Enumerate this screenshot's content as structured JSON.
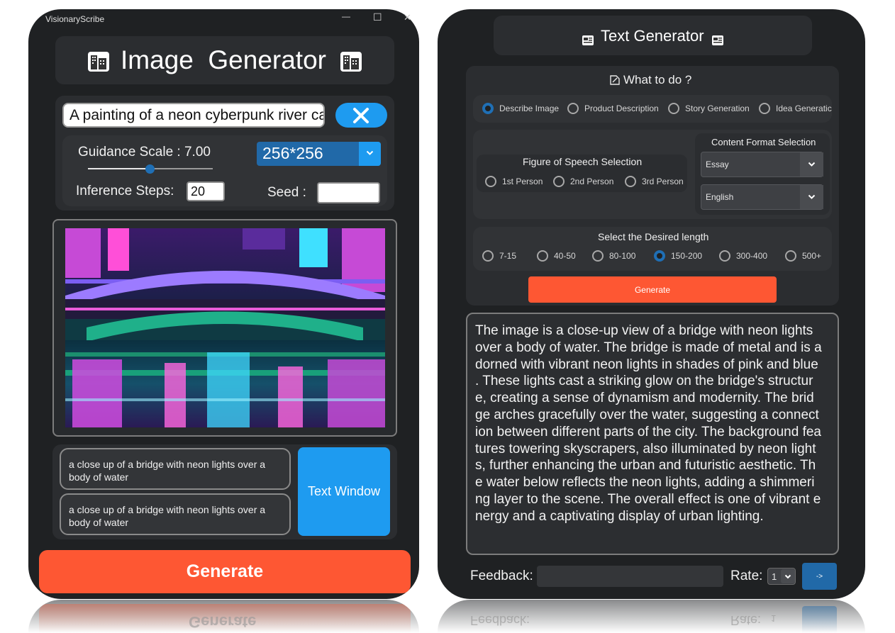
{
  "window": {
    "title": "VisionaryScribe",
    "minimize_glyph": "—",
    "maximize_glyph": "☐",
    "close_glyph": "✕"
  },
  "left": {
    "header_title": "Image  Generator",
    "prompt_value": "A painting of a neon cyberpunk river ca",
    "guidance_label": "Guidance Scale : 7.00",
    "guidance_value": 7.0,
    "guidance_slider_fraction": 0.41,
    "size_selected": "256*256",
    "inference_label": "Inference Steps:",
    "inference_value": "20",
    "seed_label": "Seed :",
    "seed_value": "",
    "captions": [
      "a close up of a bridge with neon lights over a body of water",
      "a close up of a bridge with neon lights over a body of water"
    ],
    "text_window_button": "Text Window",
    "generate_button": "Generate",
    "reflection_text": "Generate"
  },
  "right": {
    "header_title": "Text Generator",
    "what_to_do": "What to do ?",
    "modes": [
      {
        "label": "Describe Image",
        "selected": true
      },
      {
        "label": "Product Description",
        "selected": false
      },
      {
        "label": "Story Generation",
        "selected": false
      },
      {
        "label": "Idea Generatic",
        "selected": false
      }
    ],
    "speech_title": "Figure of Speech Selection",
    "speech": [
      {
        "label": "1st Person",
        "selected": false
      },
      {
        "label": "2nd Person",
        "selected": false
      },
      {
        "label": "3rd Person",
        "selected": false
      }
    ],
    "format_title": "Content Format Selection",
    "format_value": "Essay",
    "language_value": "English",
    "length_title": "Select the Desired length",
    "lengths": [
      {
        "label": "7-15",
        "selected": false
      },
      {
        "label": "40-50",
        "selected": false
      },
      {
        "label": "80-100",
        "selected": false
      },
      {
        "label": "150-200",
        "selected": true
      },
      {
        "label": "300-400",
        "selected": false
      },
      {
        "label": "500+",
        "selected": false
      }
    ],
    "generate_button": "Generate",
    "output_lines": [
      "The image is a close-up view of a bridge with neon lights",
      "over a body of water. The bridge is made of metal and is a",
      "dorned with vibrant neon lights in shades of pink and blue",
      ". These lights cast a striking glow on the bridge's structur",
      "e, creating a sense of dynamism and modernity. The brid",
      "ge arches gracefully over the water, suggesting a connect",
      "ion between different parts of the city. The background fea",
      "tures towering skyscrapers, also illuminated by neon light",
      "s, further enhancing the urban and futuristic aesthetic. Th",
      "e water below reflects the neon lights, adding a shimmeri",
      "ng layer to the scene. The overall effect is one of vibrant e",
      "nergy and a captivating display of urban lighting."
    ],
    "feedback_label": "Feedback:",
    "feedback_value": "",
    "rate_label": "Rate:",
    "rate_value": "1",
    "send_glyph": "->",
    "reflection_feedback": "Feedback:",
    "reflection_rate": "Rate:",
    "reflection_rate_value": "1"
  },
  "colors": {
    "accent_orange": "#fe5733",
    "accent_blue": "#1e9bf0",
    "select_blue": "#2169a8",
    "radio_blue": "#1f6fb5"
  }
}
